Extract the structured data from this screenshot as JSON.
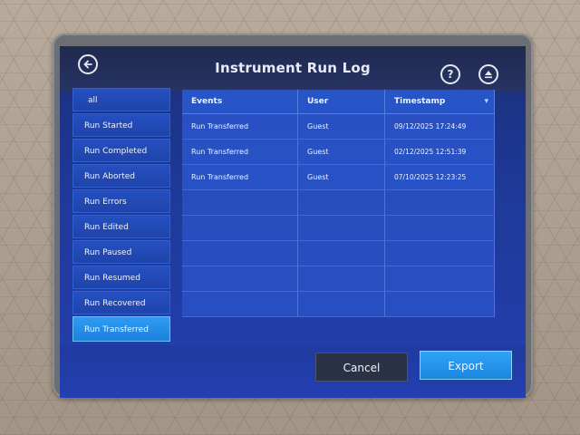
{
  "window": {
    "title": "Instrument Run Log"
  },
  "header": {
    "back_icon": "back-arrow-icon",
    "help_icon": "help-icon",
    "help_glyph": "?",
    "eject_icon": "eject-icon"
  },
  "sidebar": {
    "items": [
      {
        "label": "all",
        "active": false
      },
      {
        "label": "Run Started",
        "active": false
      },
      {
        "label": "Run Completed",
        "active": false
      },
      {
        "label": "Run Aborted",
        "active": false
      },
      {
        "label": "Run Errors",
        "active": false
      },
      {
        "label": "Run Edited",
        "active": false
      },
      {
        "label": "Run Paused",
        "active": false
      },
      {
        "label": "Run Resumed",
        "active": false
      },
      {
        "label": "Run Recovered",
        "active": false
      },
      {
        "label": "Run Transferred",
        "active": true
      }
    ]
  },
  "table": {
    "headers": [
      "Events",
      "User",
      "Timestamp"
    ],
    "rows": [
      [
        "Run Transferred",
        "Guest",
        "09/12/2025 17:24:49"
      ],
      [
        "Run Transferred",
        "Guest",
        "02/12/2025 12:51:39"
      ],
      [
        "Run Transferred",
        "Guest",
        "07/10/2025 12:23:25"
      ]
    ],
    "empty_rows": 5
  },
  "footer": {
    "cancel_label": "Cancel",
    "export_label": "Export"
  },
  "colors": {
    "accent": "#1b82df",
    "screen_bg": "#1e3a9a"
  }
}
